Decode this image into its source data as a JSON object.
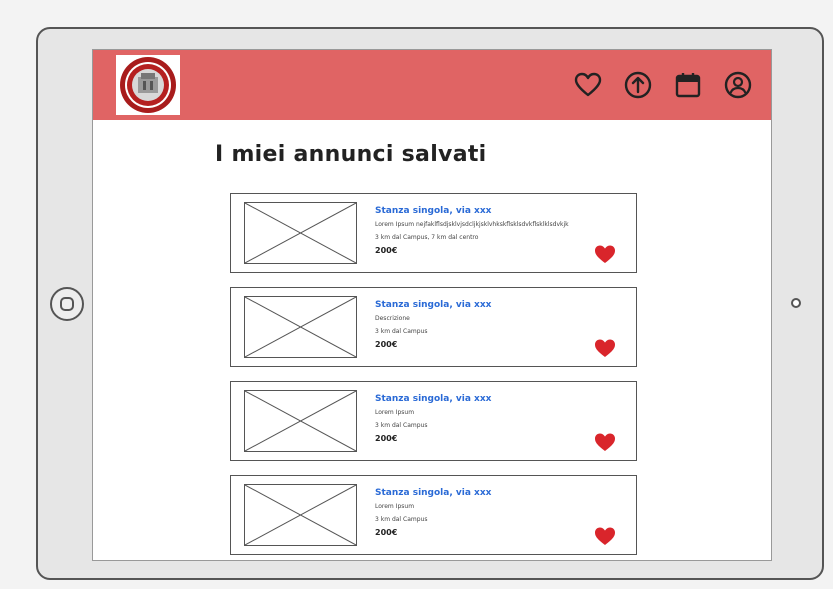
{
  "header": {
    "icons": [
      "heart-outline-icon",
      "upload-icon",
      "calendar-icon",
      "user-icon"
    ],
    "accent_color": "#e06464"
  },
  "page": {
    "title": "I miei annunci salvati"
  },
  "listings": [
    {
      "title": "Stanza singola, via xxx",
      "description": "Lorem Ipsum  nejfaklflsdjsklvjsdcljkjsklvhkskflsklsdvkflsklklsdvkjk",
      "distance": "3 km dal Campus, 7 km dal centro",
      "price": "200€",
      "saved": true
    },
    {
      "title": "Stanza singola, via xxx",
      "description": "Descrizione",
      "distance": "3 km dal Campus",
      "price": "200€",
      "saved": true
    },
    {
      "title": "Stanza singola, via xxx",
      "description": "Lorem Ipsum",
      "distance": "3 km dal Campus",
      "price": "200€",
      "saved": true
    },
    {
      "title": "Stanza singola, via xxx",
      "description": "Lorem Ipsum",
      "distance": "3 km dal Campus",
      "price": "200€",
      "saved": true
    }
  ],
  "heart_color": "#d9252b",
  "link_color": "#2a6ad6"
}
